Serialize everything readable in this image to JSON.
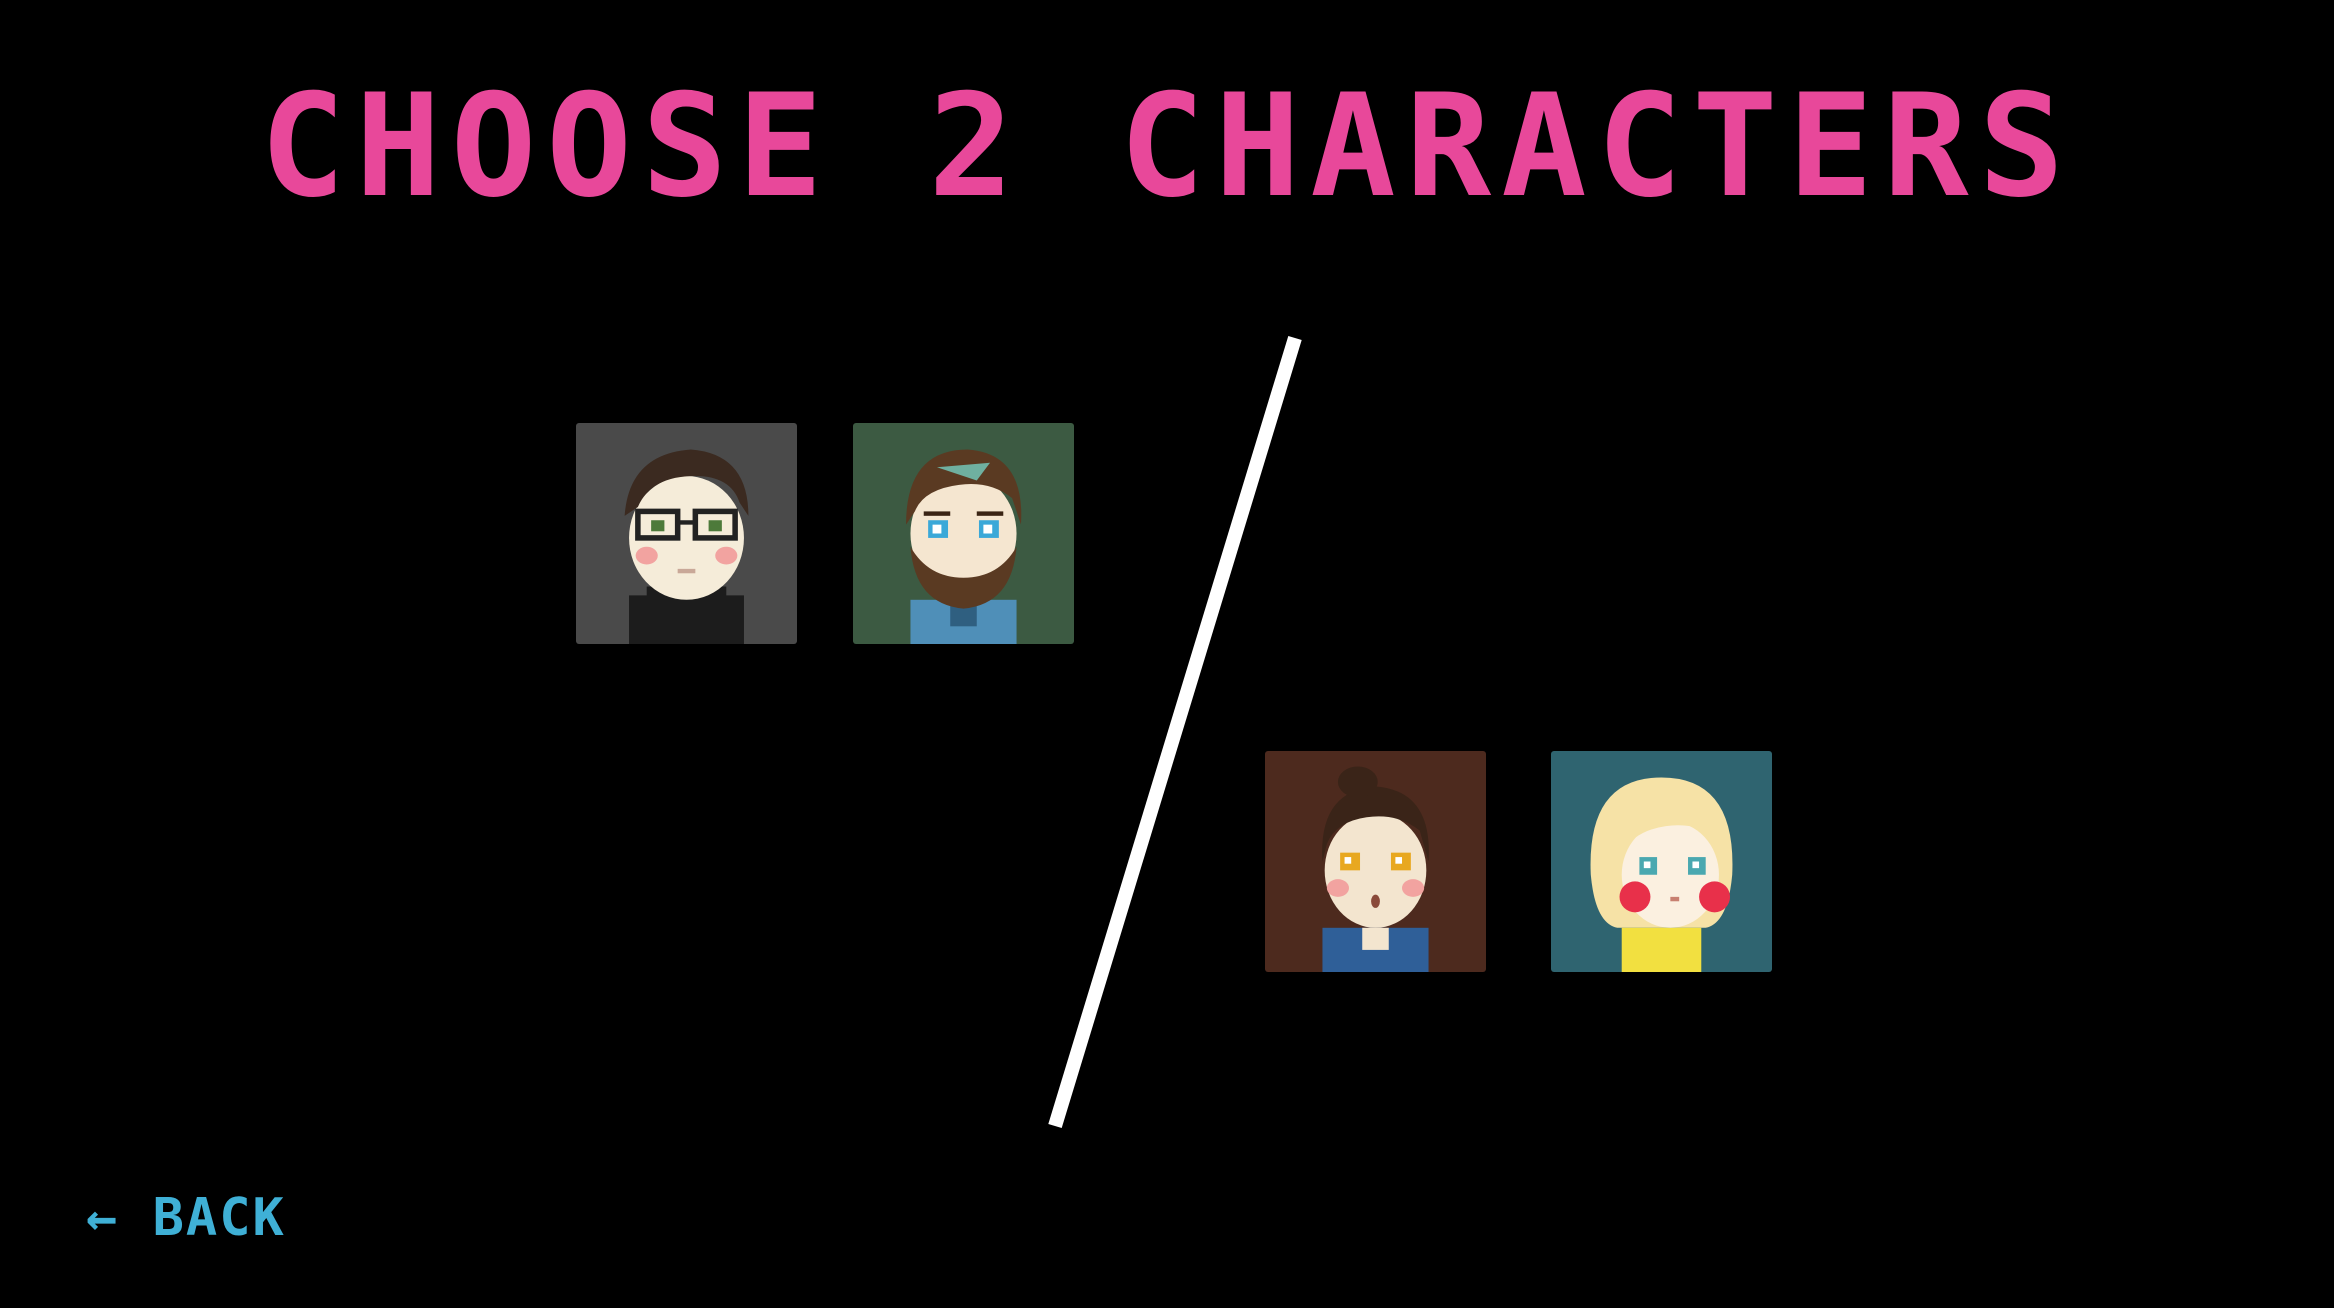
{
  "screen": {
    "title": "CHOOSE 2 CHARACTERS",
    "background_color": "#000000",
    "title_color": "#e8489a"
  },
  "characters": [
    {
      "icon": "glasses-man-portrait-icon",
      "background": "#4a4a4a"
    },
    {
      "icon": "bearded-man-portrait-icon",
      "background": "#3c5a42"
    },
    {
      "icon": "brown-hair-woman-portrait-icon",
      "background": "#4d2a1e"
    },
    {
      "icon": "blonde-girl-portrait-icon",
      "background": "#2f6470"
    }
  ],
  "navigation": {
    "back_label": "← BACK",
    "back_color": "#3fb0d6"
  }
}
